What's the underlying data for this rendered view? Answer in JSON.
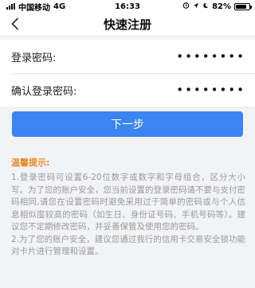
{
  "status_bar": {
    "carrier": "中国移动",
    "network": "4G",
    "time": "16:33",
    "battery": "82%",
    "battery_level": 0.82
  },
  "nav": {
    "title": "快速注册",
    "back_icon": "chevron-left-icon"
  },
  "form": {
    "login_password_label": "登录密码:",
    "login_password_value": "••••••••",
    "confirm_password_label": "确认登录密码:",
    "confirm_password_value": "••••••••"
  },
  "next_button": "下一步",
  "tips": {
    "title": "温馨提示:",
    "p1": "1.登录密码可设置6-20位数字或数字和字母组合，区分大小写。为了您的账户安全，您当前设置的登录密码请不要与支付密码相同,请您在设置密码时避免采用过于简单的密码或与个人信息相似度较高的密码（如生日、身份证号码、手机号码等）。建议您不定期修改密码，并妥善保管及使用您的密码。",
    "p2": "2.为了您的账户安全，建议您通过我行的信用卡交易安全锁功能对卡片进行管理和设置。"
  },
  "colors": {
    "accent": "#3c84f0",
    "tips_title": "#e78a2c",
    "tips_text": "#9a9a9a",
    "background": "#f2f3f5"
  }
}
